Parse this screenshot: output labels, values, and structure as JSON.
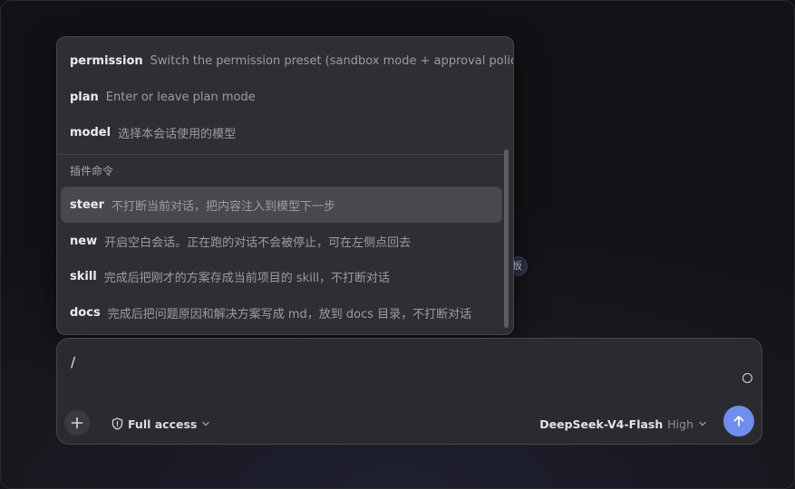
{
  "command_menu": {
    "items": [
      {
        "command": "permission",
        "description": "Switch the permission preset (sandbox mode + approval policy)"
      },
      {
        "command": "plan",
        "description": "Enter or leave plan mode"
      },
      {
        "command": "model",
        "description": "选择本会话使用的模型"
      }
    ],
    "plugin_section_label": "插件命令",
    "plugin_items": [
      {
        "command": "steer",
        "description": "不打断当前对话，把内容注入到模型下一步",
        "selected": true
      },
      {
        "command": "new",
        "description": "开启空白会话。正在跑的对话不会被停止，可在左侧点回去"
      },
      {
        "command": "skill",
        "description": "完成后把刚才的方案存成当前项目的 skill，不打断对话"
      },
      {
        "command": "docs",
        "description": "完成后把问题原因和解决方案写成 md，放到 docs 目录，不打断对话"
      }
    ]
  },
  "background_badge_text": "板",
  "composer": {
    "input_value": "/",
    "access_label": "Full access",
    "model_name": "DeepSeek-V4-Flash",
    "model_effort": "High"
  },
  "icons": {
    "plus": "plus-icon",
    "shield": "shield-icon",
    "chevron": "chevron-down-icon",
    "send": "arrow-up-icon",
    "status": "circle-icon"
  },
  "colors": {
    "send_button": "#6f8ff0",
    "popup_bg": "#2f2f33",
    "selected_row": "#48484d"
  }
}
